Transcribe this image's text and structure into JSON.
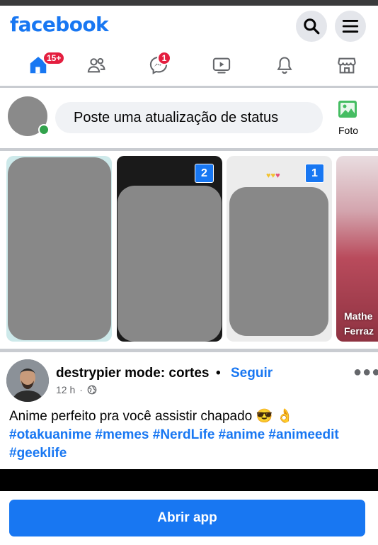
{
  "header": {
    "logo": "facebook",
    "search_icon": "search-icon",
    "menu_icon": "hamburger-menu-icon"
  },
  "nav": {
    "items": [
      {
        "name": "home",
        "icon": "home-icon",
        "badge": "15+",
        "active": true
      },
      {
        "name": "friends",
        "icon": "friends-icon",
        "badge": ""
      },
      {
        "name": "messenger",
        "icon": "messenger-icon",
        "badge": "1"
      },
      {
        "name": "watch",
        "icon": "video-icon",
        "badge": ""
      },
      {
        "name": "notifications",
        "icon": "bell-icon",
        "badge": ""
      },
      {
        "name": "marketplace",
        "icon": "marketplace-icon",
        "badge": ""
      }
    ]
  },
  "composer": {
    "placeholder": "Poste uma atualização de status",
    "photo_label": "Foto"
  },
  "stories": [
    {
      "count": "",
      "name": ""
    },
    {
      "count": "2",
      "name": ""
    },
    {
      "count": "1",
      "name": ""
    },
    {
      "count": "",
      "name": "Mathe\nFerraz"
    }
  ],
  "post": {
    "author": "destrypier mode: cortes",
    "separator": "•",
    "follow_label": "Seguir",
    "time": "12 h",
    "meta_separator": "·",
    "privacy_icon": "globe-icon",
    "text": "Anime perfeito pra você assistir chapado 😎 👌",
    "hashtags": "#otakuanime #memes #NerdLife #anime #animeedit #geeklife"
  },
  "footer": {
    "open_app_label": "Abrir app"
  },
  "colors": {
    "brand": "#1877f2",
    "badge": "#e41e3f",
    "online": "#31a24c"
  }
}
